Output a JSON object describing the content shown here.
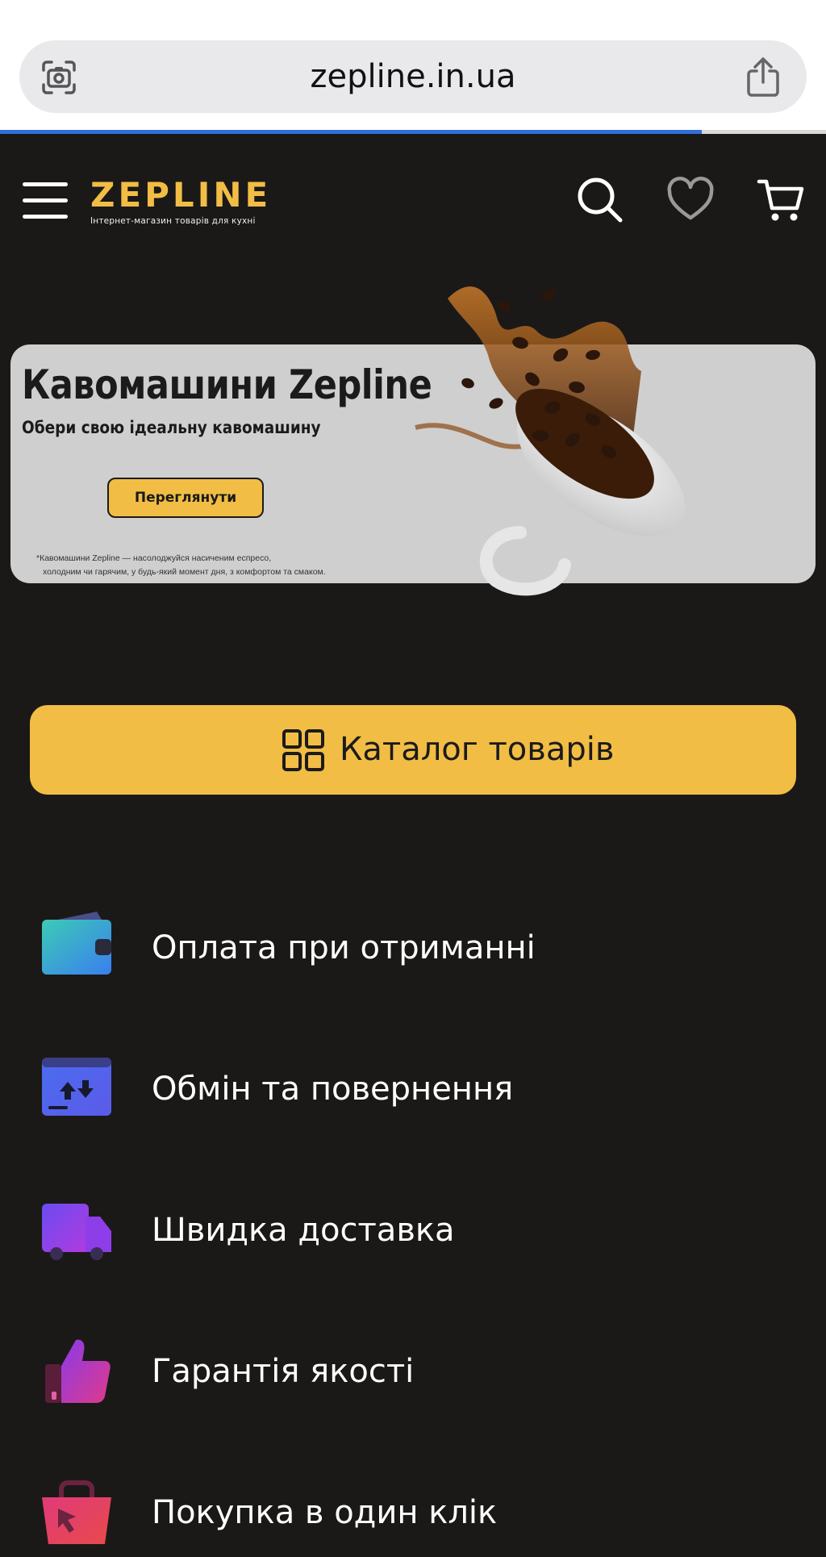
{
  "browser": {
    "url": "zepline.in.ua",
    "load_progress": 0.85
  },
  "header": {
    "logo_text": "ZEPLINE",
    "logo_tagline": "Інтернет-магазин товарів для кухні"
  },
  "banner": {
    "title": "Кавомашини Zepline",
    "subtitle": "Обери свою ідеальну кавомашину",
    "button_label": "Переглянути",
    "note_line1": "*Кавомашини Zepline — насолоджуйся насиченим еспресо,",
    "note_line2": "холодним чи гарячим, у будь-який момент дня, з комфортом та смаком."
  },
  "catalog": {
    "label": "Каталог товарів"
  },
  "features": [
    {
      "label": "Оплата при отриманні",
      "icon": "wallet-icon"
    },
    {
      "label": "Обмін та повернення",
      "icon": "exchange-icon"
    },
    {
      "label": "Швидка доставка",
      "icon": "delivery-truck-icon"
    },
    {
      "label": "Гарантія якості",
      "icon": "thumbs-up-icon"
    },
    {
      "label": "Покупка в один клік",
      "icon": "shopping-basket-icon"
    }
  ],
  "colors": {
    "page_bg": "#1a1918",
    "accent": "#f2bd45",
    "progress": "#2f6fdb"
  }
}
